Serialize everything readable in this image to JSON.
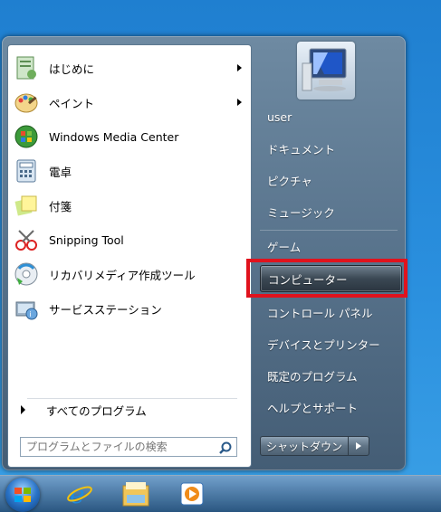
{
  "start_menu": {
    "programs": [
      {
        "label": "はじめに",
        "icon": "getting-started-icon",
        "submenu": true
      },
      {
        "label": "ペイント",
        "icon": "paint-icon",
        "submenu": true
      },
      {
        "label": "Windows Media Center",
        "icon": "media-center-icon",
        "submenu": false
      },
      {
        "label": "電卓",
        "icon": "calculator-icon",
        "submenu": false
      },
      {
        "label": "付箋",
        "icon": "sticky-notes-icon",
        "submenu": false
      },
      {
        "label": "Snipping Tool",
        "icon": "snipping-tool-icon",
        "submenu": false
      },
      {
        "label": "リカバリメディア作成ツール",
        "icon": "recovery-media-icon",
        "submenu": false
      },
      {
        "label": "サービスステーション",
        "icon": "service-station-icon",
        "submenu": false
      }
    ],
    "all_programs_label": "すべてのプログラム",
    "search": {
      "placeholder": "プログラムとファイルの検索"
    },
    "right_items": [
      {
        "label": "user"
      },
      {
        "label": "ドキュメント"
      },
      {
        "label": "ピクチャ"
      },
      {
        "label": "ミュージック"
      },
      {
        "label": "ゲーム"
      },
      {
        "label": "コンピューター",
        "highlighted": true
      },
      {
        "label": "コントロール パネル"
      },
      {
        "label": "デバイスとプリンター"
      },
      {
        "label": "既定のプログラム"
      },
      {
        "label": "ヘルプとサポート"
      }
    ],
    "shutdown_label": "シャットダウン"
  },
  "taskbar": {
    "items": [
      "start-orb-icon",
      "internet-explorer-icon",
      "explorer-folder-icon",
      "media-player-icon"
    ]
  },
  "colors": {
    "highlight_box": "#e0121d",
    "desktop": "#2a8fde"
  }
}
